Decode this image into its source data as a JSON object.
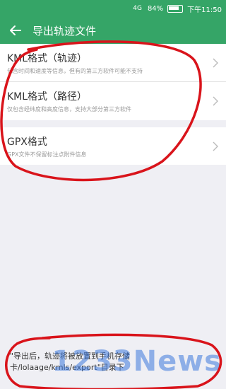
{
  "status_bar": {
    "signal": "4G",
    "battery": "84%",
    "time": "下午11:50"
  },
  "header": {
    "title": "导出轨迹文件",
    "back_icon": "back-arrow-icon"
  },
  "options": [
    {
      "label": "KML格式（轨迹）",
      "description": "包含时间和速度等信息，但有的第三方软件可能不支持"
    },
    {
      "label": "KML格式（路径）",
      "description": "仅包含经纬度和高度信息，支持大部分第三方软件"
    },
    {
      "label": "GPX格式",
      "description": "GPX文件不保留标注点附件信息"
    }
  ],
  "note": "\"导出后，轨迹将被放置到手机存储卡/lolaage/kmls/export\"目录下",
  "watermark": "1233News",
  "colors": {
    "accent": "#35a567",
    "annotation": "#d9141b",
    "watermark": "#3c78dc"
  }
}
